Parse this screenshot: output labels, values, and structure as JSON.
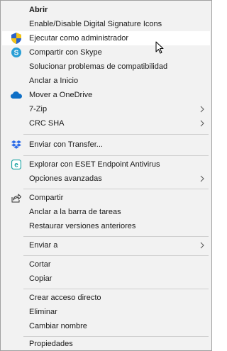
{
  "menu": {
    "items": [
      {
        "label": "Abrir",
        "bold": true
      },
      {
        "label": "Enable/Disable Digital Signature Icons"
      },
      {
        "label": "Ejecutar como administrador",
        "icon": "shield-icon"
      },
      {
        "label": "Compartir con Skype",
        "icon": "skype-icon"
      },
      {
        "label": "Solucionar problemas de compatibilidad"
      },
      {
        "label": "Anclar a Inicio"
      },
      {
        "label": "Mover a OneDrive",
        "icon": "onedrive-icon"
      },
      {
        "label": "7-Zip",
        "submenu": true
      },
      {
        "label": "CRC SHA",
        "submenu": true
      },
      {
        "label": "Enviar con Transfer...",
        "icon": "dropbox-icon"
      },
      {
        "label": "Explorar con ESET Endpoint Antivirus",
        "icon": "eset-icon"
      },
      {
        "label": "Opciones avanzadas",
        "submenu": true
      },
      {
        "label": "Compartir",
        "icon": "share-icon"
      },
      {
        "label": "Anclar a la barra de tareas"
      },
      {
        "label": "Restaurar versiones anteriores"
      },
      {
        "label": "Enviar a",
        "submenu": true
      },
      {
        "label": "Cortar"
      },
      {
        "label": "Copiar"
      },
      {
        "label": "Crear acceso directo"
      },
      {
        "label": "Eliminar"
      },
      {
        "label": "Cambiar nombre"
      },
      {
        "label": "Propiedades"
      }
    ]
  },
  "colors": {
    "menu_bg": "#f2f2f2",
    "hover_bg": "#ffffff",
    "separator": "#cfcfcf",
    "skype": "#2a9fd6",
    "onedrive": "#0f6fc6",
    "dropbox": "#2e6de8",
    "eset": "#1da5a5"
  }
}
